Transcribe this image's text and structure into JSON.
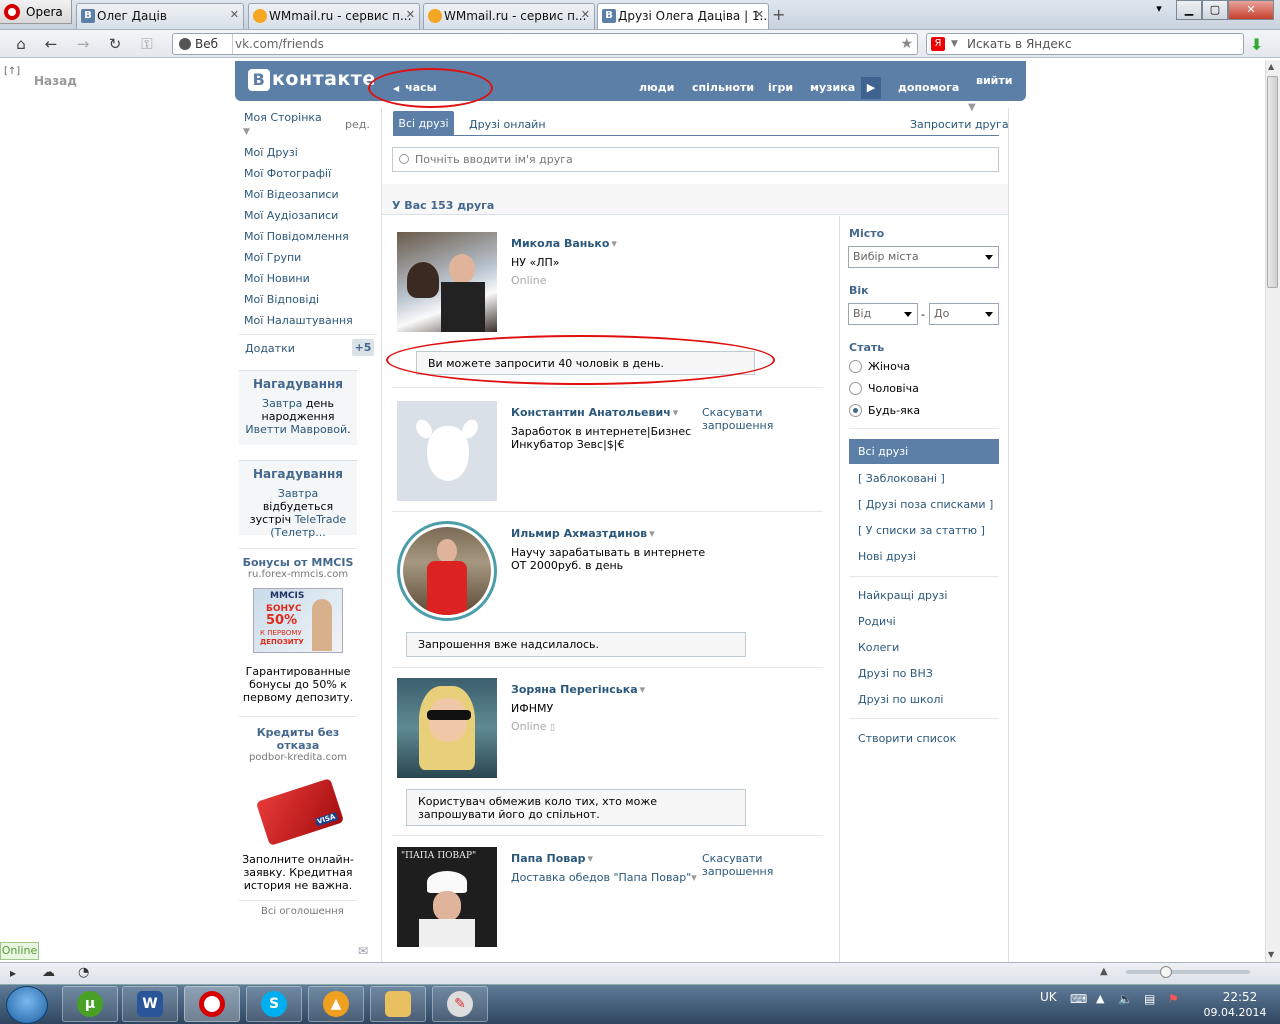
{
  "browser": {
    "opera_label": "Opera",
    "tabs": [
      {
        "title": "Олег Даців"
      },
      {
        "title": "WMmail.ru - сервис п..."
      },
      {
        "title": "WMmail.ru - сервис п..."
      },
      {
        "title": "Друзі Олега Даціва | 1..."
      }
    ],
    "address_prefix": "Веб",
    "url": "vk.com/friends",
    "search_placeholder": "Искать в Яндекс",
    "yandex_letter": "Я"
  },
  "page": {
    "back_label": "Назад",
    "back_marker": "[↑]",
    "logo_text": "контакте",
    "logo_letter": "В",
    "clock_label": "часы",
    "topnav": [
      "люди",
      "спільноти",
      "ігри",
      "музика",
      "допомога"
    ],
    "logout": "вийти"
  },
  "leftnav": {
    "items": [
      "Моя Сторінка",
      "Мої Друзі",
      "Мої Фотографії",
      "Мої Відеозаписи",
      "Мої Аудіозаписи",
      "Мої Повідомлення",
      "Мої Групи",
      "Мої Новини",
      "Мої Відповіді",
      "Мої Налаштування"
    ],
    "edit": "ред.",
    "apps": "Додатки",
    "apps_badge": "+5"
  },
  "reminders": [
    {
      "title": "Нагадування",
      "link1": "Завтра",
      "text1": " день народження ",
      "link2": "Иветти Мавровой",
      "text2": "."
    },
    {
      "title": "Нагадування",
      "link1": "Завтра",
      "text1": " відбудеться зустріч ",
      "link2": "TeleTrade (Телетр...",
      "text2": ""
    }
  ],
  "ads": [
    {
      "title": "Бонусы от MMCIS",
      "domain": "ru.forex-mmcis.com",
      "banner_brand": "MMCIS",
      "banner_line1": "БОНУС",
      "banner_line2": "50%",
      "banner_line3": "К ПЕРВОМУ",
      "banner_line4": "ДЕПОЗИТУ",
      "text": "Гарантированные бонусы до 50% к первому депозиту."
    },
    {
      "title": "Кредиты без отказа",
      "domain": "podbor-kredita.com",
      "banner_brand": "VISA",
      "text": "Заполните онлайн-заявку. Кредитная история не важна."
    }
  ],
  "all_ads": "Всі оголошення",
  "friends": {
    "tab_all": "Всі друзі",
    "tab_online": "Друзі онлайн",
    "invite": "Запросити друга",
    "search_placeholder": "Почніть вводити ім'я друга",
    "count": "У Вас 153 друга",
    "list": [
      {
        "name": "Микола Ванько",
        "line1": "НУ «ЛП»",
        "status": "Online",
        "message": "Ви можете запросити 40 чоловік в день."
      },
      {
        "name": "Константин Анатольевич",
        "line1": "Заработок в интернете|Бизнес",
        "line2": "Инкубатор Зевс|$|€",
        "cancel": "Скасувати запрошення"
      },
      {
        "name": "Ильмир Ахмазтдинов",
        "line1": "Научу зарабатывать в интернете",
        "line2": "ОТ 2000руб. в день",
        "message": "Запрошення вже надсилалось."
      },
      {
        "name": "Зоряна Перегінська",
        "line1": "ИФНМУ",
        "status": "Online",
        "message": "Користувач обмежив коло тих, хто може запрошувати його до спільнот."
      },
      {
        "name": "Папа Повар",
        "line1": "Доставка обедов \"Папа Повар\"",
        "cancel": "Скасувати запрошення",
        "photo_caption": "\"ПАПА ПОВАР\""
      }
    ]
  },
  "filter": {
    "city_label": "Місто",
    "city_select": "Вибір міста",
    "age_label": "Вік",
    "age_from": "Від",
    "age_dash": "-",
    "age_to": "До",
    "sex_label": "Стать",
    "sex_options": [
      "Жіноча",
      "Чоловіча",
      "Будь-яка"
    ],
    "sex_selected": "Будь-яка",
    "lists": [
      "Всі друзі",
      "[ Заблоковані ]",
      "[ Друзі поза списками ]",
      "[ У списки за статтю ]",
      "Нові друзі"
    ],
    "lists2": [
      "Найкращі друзі",
      "Родичі",
      "Колеги",
      "Друзі по ВНЗ",
      "Друзі по школі"
    ],
    "create_list": "Створити список"
  },
  "status": {
    "online": "Online"
  },
  "taskbar": {
    "lang": "UK",
    "time": "22:52",
    "date": "09.04.2014"
  },
  "colors": {
    "vk_blue": "#5b7fa6",
    "link": "#2b587a",
    "annotation": "#e01010"
  }
}
